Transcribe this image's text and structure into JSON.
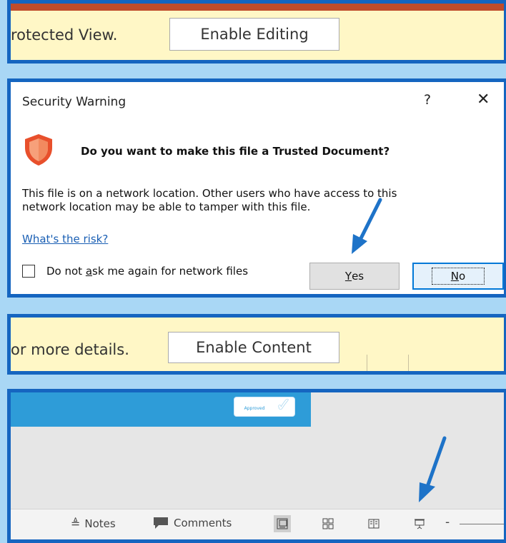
{
  "protected_bar": {
    "message": "rotected View.",
    "button_label": "Enable Editing"
  },
  "security_dialog": {
    "title": "Security Warning",
    "help_glyph": "?",
    "close_glyph": "✕",
    "question": "Do you want to make this file a Trusted Document?",
    "body_line1": "This file is on a network location. Other users who have access to this",
    "body_line2": "network location may be able to tamper with this file.",
    "risk_link": "What's the risk?",
    "checkbox_label_pre": "Do not ",
    "checkbox_label_accel": "a",
    "checkbox_label_post": "sk me again for network files",
    "yes_accel": "Y",
    "yes_rest": "es",
    "no_accel": "N",
    "no_rest": "o",
    "shield_color": "#e8502c"
  },
  "content_bar": {
    "message": "or more details.",
    "button_label": "Enable Content"
  },
  "slide_area": {
    "badge_text": "Approved",
    "accent": "#2e9cd8"
  },
  "status_bar": {
    "notes_label": "Notes",
    "comments_label": "Comments",
    "zoom_minus": "-"
  },
  "colors": {
    "panel_border": "#1565c0",
    "background": "#a9d7f5",
    "message_bar": "#fff7c6",
    "arrow": "#1e73c8"
  }
}
